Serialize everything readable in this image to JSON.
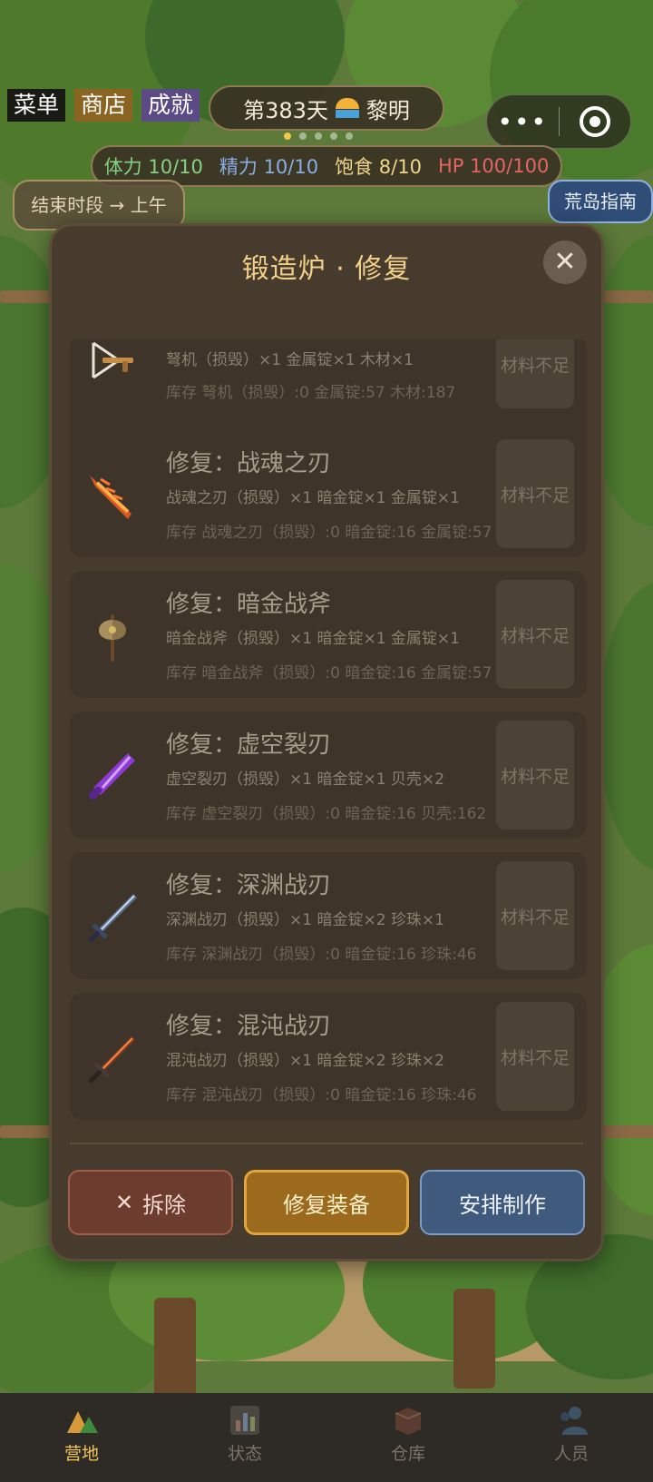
{
  "top_tabs": {
    "menu": "菜单",
    "shop": "商店",
    "achievements": "成就"
  },
  "day": {
    "text": "第383天",
    "period": "黎明"
  },
  "page_dots": {
    "count": 5,
    "active_index": 0
  },
  "capsule": {
    "more": "•••"
  },
  "stats": {
    "stamina": "体力 10/10",
    "energy": "精力 10/10",
    "food": "饱食 8/10",
    "hp": "HP 100/100"
  },
  "end_period_button": "结束时段 → 上午",
  "guide_button": "荒岛指南",
  "modal": {
    "title": "锻造炉 · 修复",
    "close": "✕",
    "items": [
      {
        "title": "",
        "need": "弩机（损毁）×1  金属锭×1  木材×1",
        "stock": "库存 弩机（损毁）:0  金属锭:57  木材:187",
        "status": "材料不足",
        "icon": "crossbow-icon"
      },
      {
        "title": "修复：战魂之刃",
        "need": "战魂之刃（损毁）×1  暗金锭×1  金属锭×1",
        "stock": "库存 战魂之刃（损毁）:0  暗金锭:16  金属锭:57",
        "status": "材料不足",
        "icon": "flame-blade-icon"
      },
      {
        "title": "修复：暗金战斧",
        "need": "暗金战斧（损毁）×1  暗金锭×1  金属锭×1",
        "stock": "库存 暗金战斧（损毁）:0  暗金锭:16  金属锭:57",
        "status": "材料不足",
        "icon": "battle-axe-icon"
      },
      {
        "title": "修复：虚空裂刃",
        "need": "虚空裂刃（损毁）×1  暗金锭×1  贝壳×2",
        "stock": "库存 虚空裂刃（损毁）:0  暗金锭:16  贝壳:162",
        "status": "材料不足",
        "icon": "void-blade-icon"
      },
      {
        "title": "修复：深渊战刃",
        "need": "深渊战刃（损毁）×1  暗金锭×2  珍珠×1",
        "stock": "库存 深渊战刃（损毁）:0  暗金锭:16  珍珠:46",
        "status": "材料不足",
        "icon": "abyss-sword-icon"
      },
      {
        "title": "修复：混沌战刃",
        "need": "混沌战刃（损毁）×1  暗金锭×2  珍珠×2",
        "stock": "库存 混沌战刃（损毁）:0  暗金锭:16  珍珠:46",
        "status": "材料不足",
        "icon": "chaos-sword-icon"
      }
    ],
    "buttons": {
      "dismantle": "拆除",
      "dismantle_icon": "✕",
      "repair": "修复装备",
      "schedule": "安排制作"
    }
  },
  "bottom_nav": [
    {
      "label": "营地",
      "icon": "camp-icon",
      "active": true
    },
    {
      "label": "状态",
      "icon": "chart-icon",
      "active": false
    },
    {
      "label": "仓库",
      "icon": "box-icon",
      "active": false
    },
    {
      "label": "人员",
      "icon": "people-icon",
      "active": false
    }
  ]
}
